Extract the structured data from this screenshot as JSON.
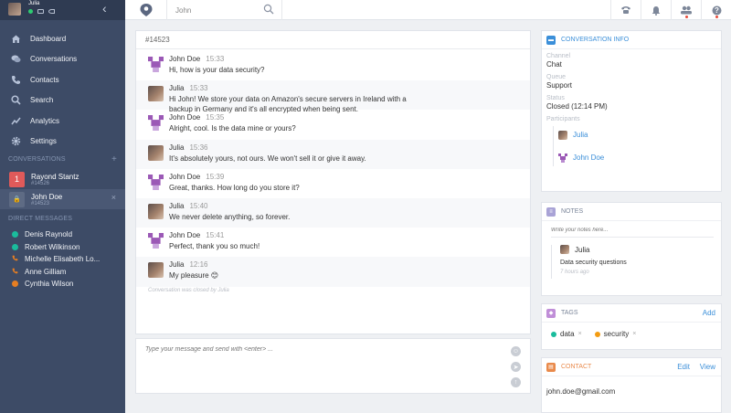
{
  "colors": {
    "sidebar": "#3d4b66",
    "accent": "#3b8fd9",
    "green": "#2ecc71",
    "orange": "#e67e22",
    "red": "#e74c3c",
    "teal": "#1abc9c",
    "purple": "#9b59b6"
  },
  "user": {
    "name": "Julia"
  },
  "nav": [
    {
      "label": "Dashboard",
      "icon": "home-icon"
    },
    {
      "label": "Conversations",
      "icon": "chat-icon"
    },
    {
      "label": "Contacts",
      "icon": "phone-icon"
    },
    {
      "label": "Search",
      "icon": "search-icon"
    },
    {
      "label": "Analytics",
      "icon": "chart-icon"
    },
    {
      "label": "Settings",
      "icon": "gear-icon"
    }
  ],
  "conversations": {
    "heading": "CONVERSATIONS",
    "add": "+",
    "items": [
      {
        "badge": "1",
        "name": "Rayond Stantz",
        "id": "#14526"
      },
      {
        "badge": "🔒",
        "name": "John Doe",
        "id": "#14523",
        "close": "×"
      }
    ]
  },
  "direct_messages": {
    "heading": "DIRECT MESSAGES",
    "items": [
      {
        "name": "Denis Raynold",
        "kind": "dot",
        "color": "#1abc9c"
      },
      {
        "name": "Robert Wilkinson",
        "kind": "dot",
        "color": "#1abc9c"
      },
      {
        "name": "Michelle Elisabeth Lo...",
        "kind": "phone"
      },
      {
        "name": "Anne Gilliam",
        "kind": "phone"
      },
      {
        "name": "Cynthia Wilson",
        "kind": "dot",
        "color": "#e67e22"
      }
    ]
  },
  "search": {
    "value": "John"
  },
  "chat": {
    "id": "#14523",
    "messages": [
      {
        "author": "John Doe",
        "time": "15:33",
        "text": "Hi, how is your data security?",
        "who": "john"
      },
      {
        "author": "Julia",
        "time": "15:33",
        "text": "Hi John! We store your data on Amazon's secure servers in Ireland with a backup in Germany and it's all encrypted when being sent.",
        "who": "julia"
      },
      {
        "author": "John Doe",
        "time": "15:35",
        "text": "Alright, cool. Is the data mine or yours?",
        "who": "john"
      },
      {
        "author": "Julia",
        "time": "15:36",
        "text": "It's absolutely yours, not ours. We won't sell it or give it away.",
        "who": "julia"
      },
      {
        "author": "John Doe",
        "time": "15:39",
        "text": "Great, thanks. How long do you store it?",
        "who": "john"
      },
      {
        "author": "Julia",
        "time": "15:40",
        "text": "We never delete anything, so forever.",
        "who": "julia"
      },
      {
        "author": "John Doe",
        "time": "15:41",
        "text": "Perfect, thank you so much!",
        "who": "john"
      },
      {
        "author": "Julia",
        "time": "12:16",
        "text": "My pleasure 😊",
        "who": "julia"
      }
    ],
    "closed_note": "Conversation was closed by Julia",
    "composer_placeholder": "Type your message and send with <enter> ..."
  },
  "info": {
    "heading": "CONVERSATION INFO",
    "channel_label": "Channel",
    "channel": "Chat",
    "queue_label": "Queue",
    "queue": "Support",
    "status_label": "Status",
    "status": "Closed (12:14 PM)",
    "participants_label": "Participants",
    "participants": [
      "Julia",
      "John Doe"
    ]
  },
  "notes": {
    "heading": "NOTES",
    "placeholder": "Write your notes here...",
    "author": "Julia",
    "text": "Data security questions",
    "time": "7 hours ago"
  },
  "tags": {
    "heading": "TAGS",
    "add": "Add",
    "items": [
      {
        "label": "data",
        "color": "#1abc9c"
      },
      {
        "label": "security",
        "color": "#f39c12"
      }
    ]
  },
  "contact": {
    "heading": "CONTACT",
    "edit": "Edit",
    "view": "View",
    "email": "john.doe@gmail.com"
  }
}
